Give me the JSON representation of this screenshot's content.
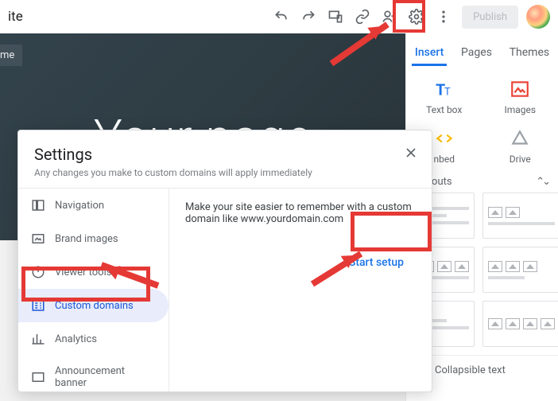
{
  "toolbar": {
    "site_title": "ite",
    "publish_label": "Publish"
  },
  "hero": {
    "title": "Your page",
    "home_tab": "me"
  },
  "side": {
    "tabs": [
      "Insert",
      "Pages",
      "Themes"
    ],
    "textbox": "Text box",
    "images": "Images",
    "embed": "nbed",
    "drive": "Drive",
    "layouts": "Layouts",
    "collapsible": "Collapsible text"
  },
  "dialog": {
    "title": "Settings",
    "subtitle": "Any changes you make to custom domains will apply immediately",
    "nav": {
      "navigation": "Navigation",
      "brand": "Brand images",
      "viewer": "Viewer tools",
      "custom": "Custom domains",
      "analytics": "Analytics",
      "announce": "Announcement banner"
    },
    "body_text": "Make your site easier to remember with a custom domain like www.yourdomain.com",
    "start_setup": "Start setup"
  }
}
